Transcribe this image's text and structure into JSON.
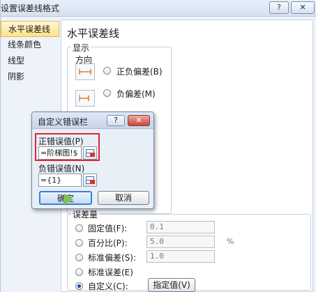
{
  "window": {
    "title": "设置误差线格式",
    "help_label": "?",
    "close_label": "✕"
  },
  "sidebar": {
    "items": [
      {
        "label": "水平误差线",
        "active": true
      },
      {
        "label": "线条颜色"
      },
      {
        "label": "线型"
      },
      {
        "label": "阴影"
      }
    ]
  },
  "main": {
    "heading": "水平误差线",
    "display_group": "显示",
    "direction_label": "方向",
    "direction_options": [
      {
        "label": "正负偏差(B)",
        "selected": false,
        "icon": "plus-minus-error-bar-icon"
      },
      {
        "label": "负偏差(M)",
        "selected": false,
        "icon": "minus-error-bar-icon"
      }
    ],
    "amount_group": "误差量",
    "amount_options": [
      {
        "label": "固定值(F):",
        "value": "0.1",
        "selected": false
      },
      {
        "label": "百分比(P):",
        "value": "5.0",
        "unit": "%",
        "selected": false
      },
      {
        "label": "标准偏差(S):",
        "value": "1.0",
        "selected": false
      },
      {
        "label": "标准误差(E)",
        "selected": false
      },
      {
        "label": "自定义(C):",
        "selected": true
      }
    ],
    "specify_button": "指定值(V)"
  },
  "dialog": {
    "title": "自定义错误栏",
    "help_label": "?",
    "close_label": "✕",
    "positive_label": "正错误值(P)",
    "positive_value": "=阶梯图!$",
    "negative_label": "负错误值(N)",
    "negative_value": "={1}",
    "ok_label": "确定",
    "cancel_label": "取消"
  },
  "colors": {
    "highlight_box": "#e0232e",
    "sidebar_active": "#ffe38a",
    "ok_border": "#3c7fd3"
  }
}
